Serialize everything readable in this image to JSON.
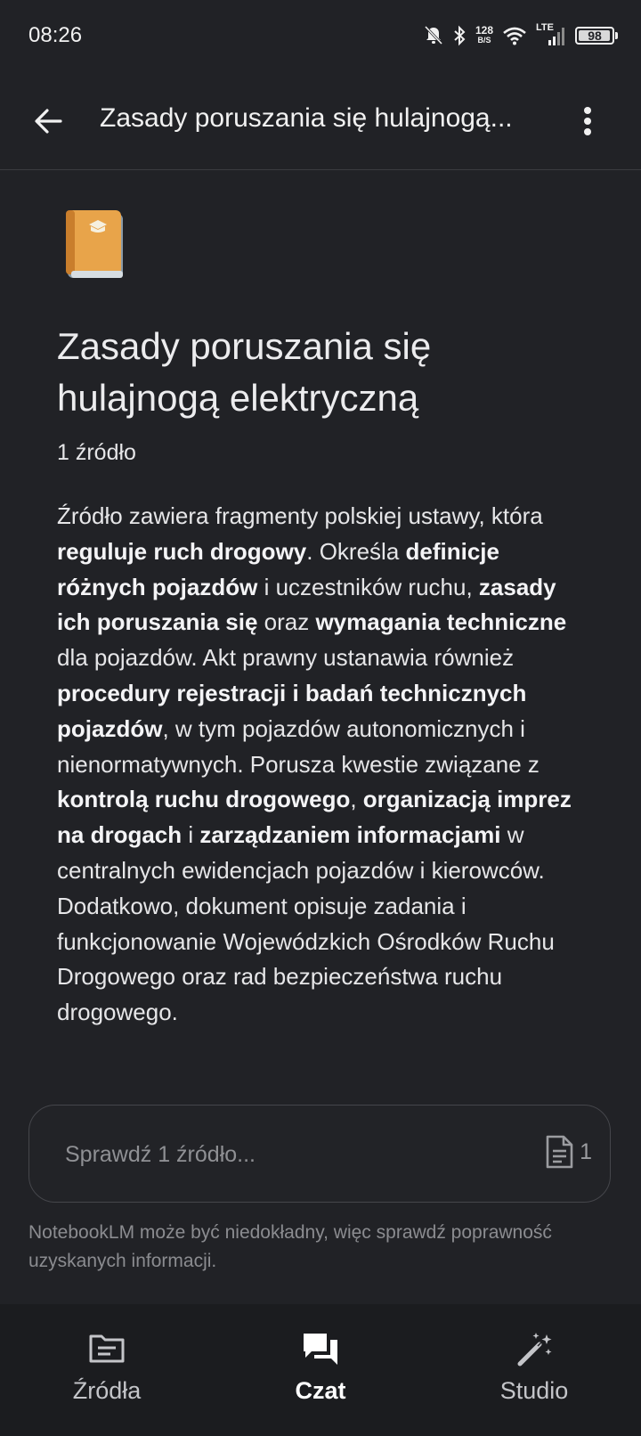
{
  "status_bar": {
    "time": "08:26",
    "net_speed_value": "128",
    "net_speed_unit": "B/S",
    "network": "LTE",
    "battery": "98",
    "battery_level_percent": 98,
    "icons": [
      "bell-off-icon",
      "bluetooth-icon",
      "wifi-icon",
      "signal-icon",
      "battery-icon"
    ]
  },
  "app_bar": {
    "title": "Zasady poruszania się hulajnogą...",
    "back_icon": "arrow-back-icon",
    "menu_icon": "more-vert-icon"
  },
  "notebook": {
    "emoji_icon": "notebook-book-icon",
    "title": "Zasady poruszania się hulajnogą elektryczną",
    "source_count": "1 źródło",
    "summary": {
      "p1": "Źródło zawiera fragmenty polskiej ustawy, która ",
      "b1": "reguluje ruch drogowy",
      "p2": ". Określa ",
      "b2": "definicje różnych pojazdów",
      "p3": " i uczestników ruchu, ",
      "b3": "zasady ich poruszania się",
      "p4": " oraz ",
      "b4": "wymagania techniczne",
      "p5": " dla pojazdów. Akt prawny ustanawia również ",
      "b5": "procedury rejestracji i badań technicznych pojazdów",
      "p6": ", w tym pojazdów autonomicznych i nienormatywnych. Porusza kwestie związane z ",
      "b6": "kontrolą ruchu drogowego",
      "p7": ", ",
      "b7": "organizacją imprez na drogach",
      "p8": " i ",
      "b8": "zarządzaniem informacjami",
      "p9": " w centralnych ewidencjach pojazdów i kierowców. Dodatkowo, dokument opisuje zadania i funkcjonowanie Wojewódzkich Ośrodków Ruchu Drogowego oraz rad bezpieczeństwa ruchu drogowego."
    }
  },
  "query": {
    "placeholder": "Sprawdź 1 źródło...",
    "source_badge_count": "1",
    "source_badge_icon": "document-icon"
  },
  "disclaimer": "NotebookLM może być niedokładny, więc sprawdź poprawność uzyskanych informacji.",
  "bottom_nav": {
    "items": [
      {
        "label": "Źródła",
        "icon": "sources-icon",
        "active": false
      },
      {
        "label": "Czat",
        "icon": "chat-icon",
        "active": true
      },
      {
        "label": "Studio",
        "icon": "magic-wand-icon",
        "active": false
      }
    ]
  },
  "colors": {
    "background": "#212226",
    "bottom_nav": "#1b1c1f",
    "text": "#e6e6e8",
    "muted": "#8b8c90",
    "notebook_orange": "#e8a44a"
  }
}
